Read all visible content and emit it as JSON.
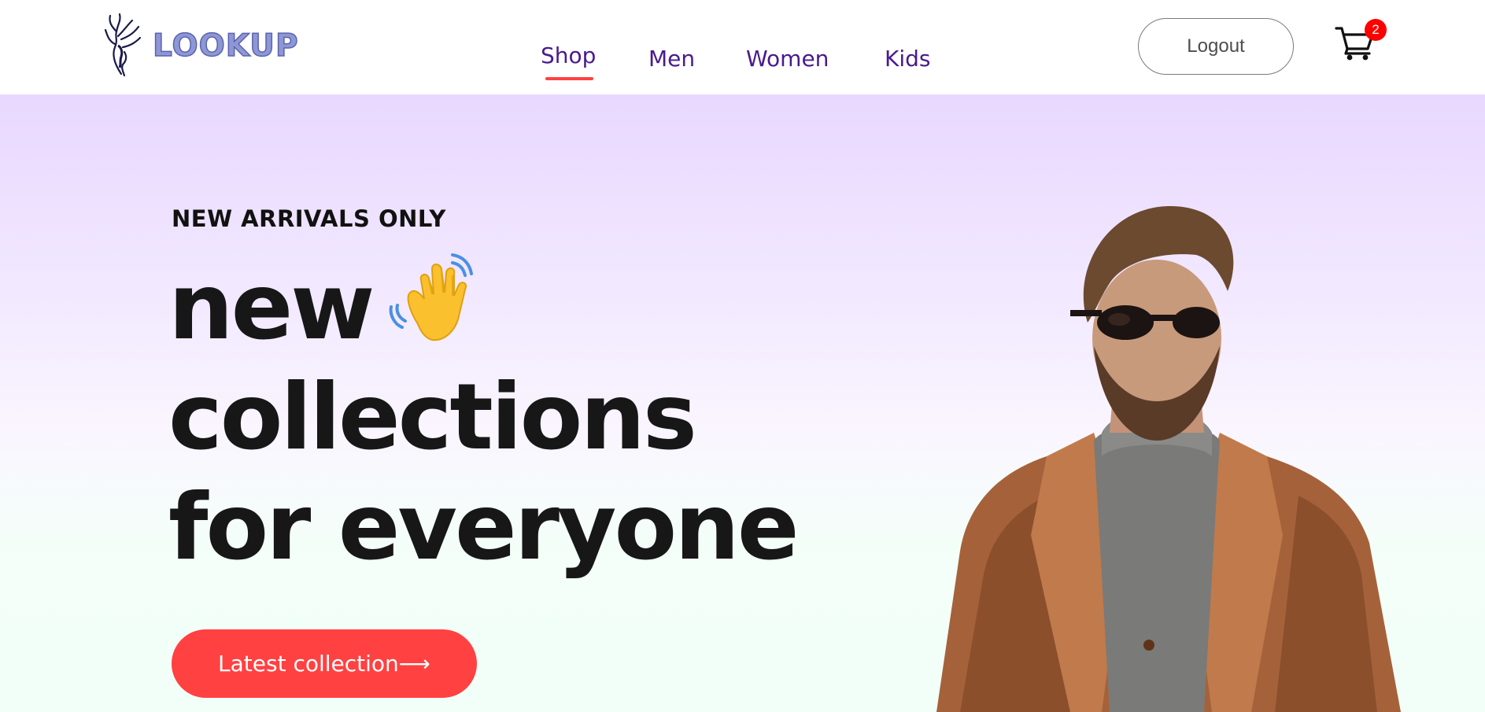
{
  "navbar": {
    "logo_text": "LOOKUP",
    "links": [
      {
        "label": "Shop",
        "active": true
      },
      {
        "label": "Men",
        "active": false
      },
      {
        "label": "Women",
        "active": false
      },
      {
        "label": "Kids",
        "active": false
      }
    ],
    "logout_label": "Logout",
    "cart_count": "2"
  },
  "hero": {
    "kicker": "NEW ARRIVALS ONLY",
    "heading_lines": [
      "new",
      "collections",
      "for everyone"
    ],
    "cta_label": "Latest collection⟶",
    "icons": {
      "waving_hand": "waving-hand-icon",
      "cart": "shopping-cart-icon"
    }
  },
  "colors": {
    "accent": "#ff4141",
    "nav_text": "#4a1a8e",
    "heading": "#171717",
    "hero_gradient_top": "#e8d8ff",
    "hero_gradient_bottom": "#f2fff8",
    "badge": "#ff0000"
  }
}
